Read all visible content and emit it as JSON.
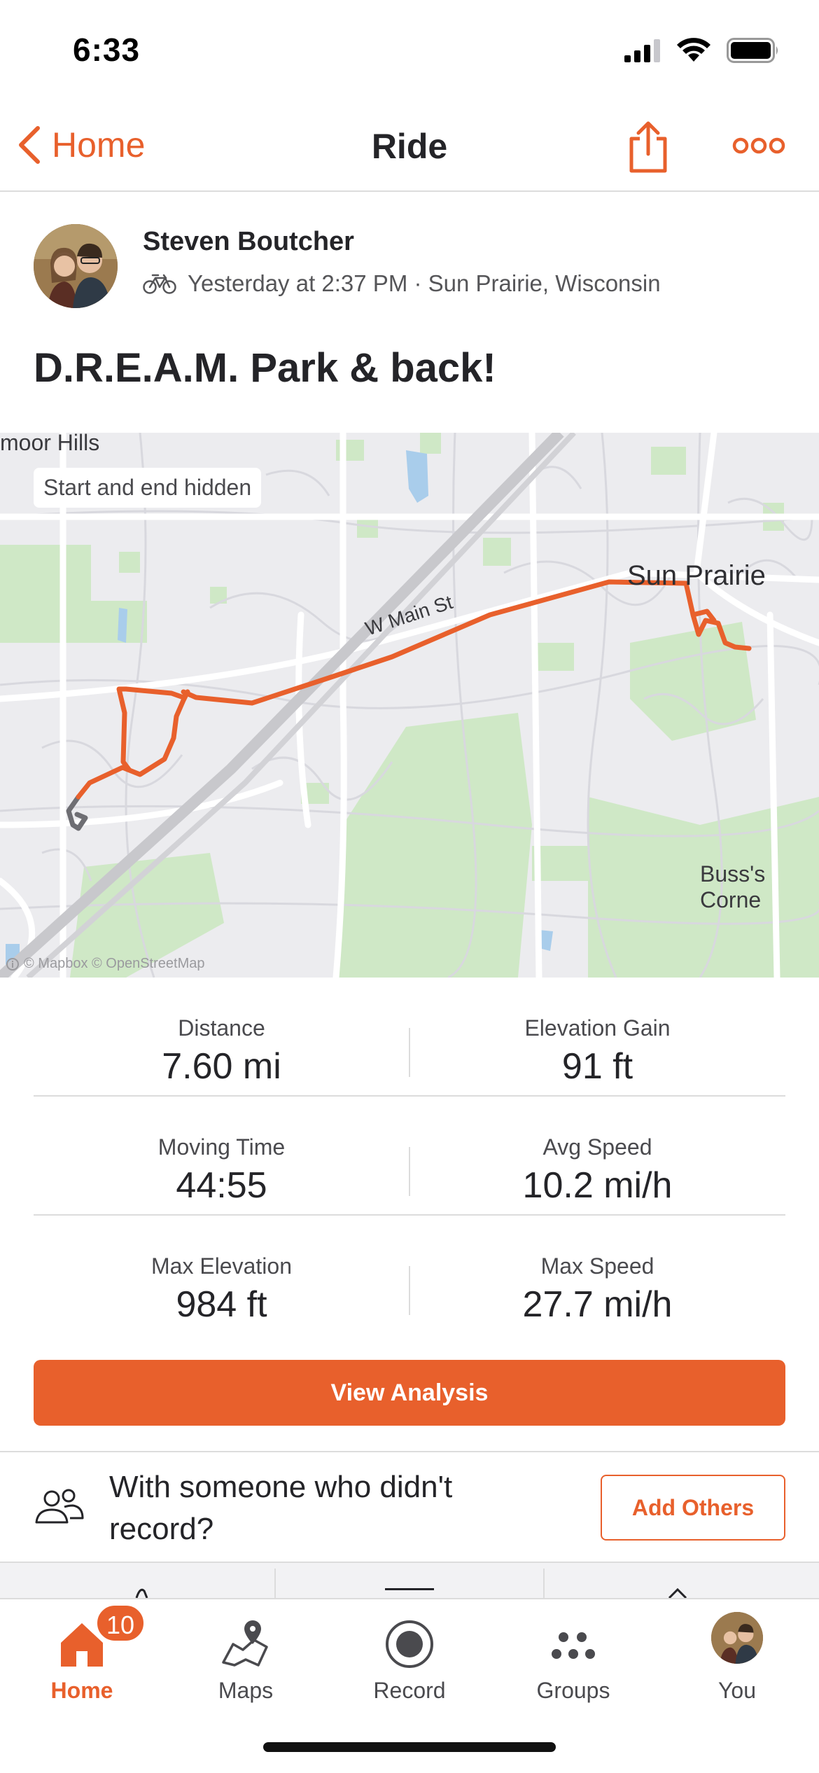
{
  "status_bar": {
    "time": "6:33"
  },
  "nav": {
    "back_label": "Home",
    "title": "Ride",
    "icons": [
      "chevron-left-icon",
      "share-icon",
      "more-icon"
    ]
  },
  "activity": {
    "athlete_name": "Steven Boutcher",
    "sport_icon": "bike-icon",
    "meta": "Yesterday at 2:37 PM · Sun Prairie, Wisconsin",
    "title": "D.R.E.A.M. Park & back!"
  },
  "map": {
    "badge": "Start and end hidden",
    "labels": {
      "top_left": "moor Hills",
      "city": "Sun Prairie",
      "street": "W Main St",
      "bottom_right": "Buss's Corne"
    },
    "attribution": "© Mapbox © OpenStreetMap",
    "route_color": "#e8602c"
  },
  "stats": [
    {
      "left": {
        "label": "Distance",
        "value": "7.60 mi"
      },
      "right": {
        "label": "Elevation Gain",
        "value": "91 ft"
      }
    },
    {
      "left": {
        "label": "Moving Time",
        "value": "44:55"
      },
      "right": {
        "label": "Avg Speed",
        "value": "10.2 mi/h"
      }
    },
    {
      "left": {
        "label": "Max Elevation",
        "value": "984 ft"
      },
      "right": {
        "label": "Max Speed",
        "value": "27.7 mi/h"
      }
    }
  ],
  "analysis_button": "View Analysis",
  "with_someone": {
    "text": "With someone who didn't record?",
    "button": "Add Others"
  },
  "tab_bar": {
    "tabs": [
      {
        "label": "Home",
        "icon": "home-icon",
        "active": true,
        "badge": "10"
      },
      {
        "label": "Maps",
        "icon": "maps-icon"
      },
      {
        "label": "Record",
        "icon": "record-icon"
      },
      {
        "label": "Groups",
        "icon": "groups-icon"
      },
      {
        "label": "You",
        "icon": "avatar"
      }
    ]
  },
  "colors": {
    "accent": "#e8602c",
    "text": "#242428",
    "muted": "#4a4a4e",
    "divider": "#dcdcdc"
  }
}
